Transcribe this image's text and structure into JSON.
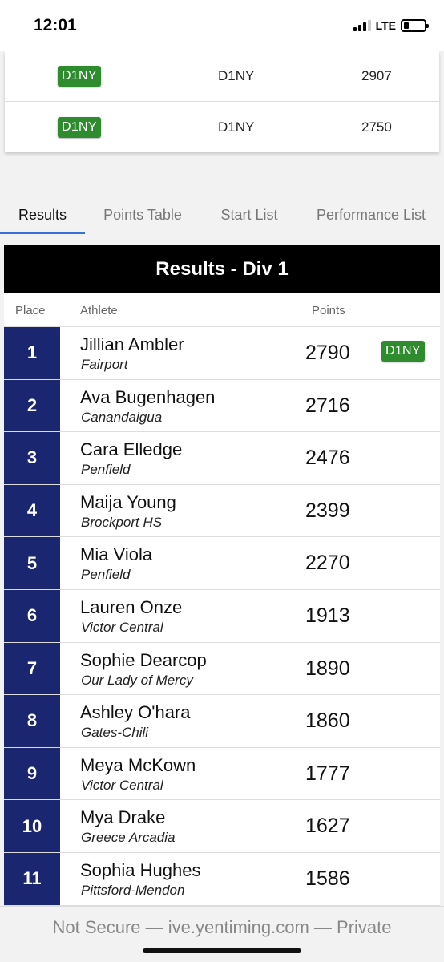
{
  "status": {
    "time": "12:01",
    "network": "LTE"
  },
  "previous": [
    {
      "badge": "D1NY",
      "team": "D1NY",
      "points": "2907"
    },
    {
      "badge": "D1NY",
      "team": "D1NY",
      "points": "2750"
    }
  ],
  "tabs": [
    "Results",
    "Points Table",
    "Start List",
    "Performance List"
  ],
  "results": {
    "title": "Results - Div 1",
    "headers": {
      "place": "Place",
      "athlete": "Athlete",
      "points": "Points"
    },
    "rows": [
      {
        "place": "1",
        "name": "Jillian Ambler",
        "school": "Fairport",
        "points": "2790",
        "badge": "D1NY"
      },
      {
        "place": "2",
        "name": "Ava Bugenhagen",
        "school": "Canandaigua",
        "points": "2716",
        "badge": ""
      },
      {
        "place": "3",
        "name": "Cara Elledge",
        "school": "Penfield",
        "points": "2476",
        "badge": ""
      },
      {
        "place": "4",
        "name": "Maija Young",
        "school": "Brockport HS",
        "points": "2399",
        "badge": ""
      },
      {
        "place": "5",
        "name": "Mia Viola",
        "school": "Penfield",
        "points": "2270",
        "badge": ""
      },
      {
        "place": "6",
        "name": "Lauren Onze",
        "school": "Victor Central",
        "points": "1913",
        "badge": ""
      },
      {
        "place": "7",
        "name": "Sophie Dearcop",
        "school": "Our Lady of Mercy",
        "points": "1890",
        "badge": ""
      },
      {
        "place": "8",
        "name": "Ashley O'hara",
        "school": "Gates-Chili",
        "points": "1860",
        "badge": ""
      },
      {
        "place": "9",
        "name": "Meya McKown",
        "school": "Victor Central",
        "points": "1777",
        "badge": ""
      },
      {
        "place": "10",
        "name": "Mya Drake",
        "school": "Greece Arcadia",
        "points": "1627",
        "badge": ""
      },
      {
        "place": "11",
        "name": "Sophia Hughes",
        "school": "Pittsford-Mendon",
        "points": "1586",
        "badge": ""
      }
    ]
  },
  "url_bar": {
    "text": "Not Secure — ive.yentiming.com — Private"
  },
  "colors": {
    "badge": "#2e8b2e",
    "place_bg": "#1b2670",
    "tab_accent": "#3a6fd8",
    "header_bg": "#000000"
  }
}
